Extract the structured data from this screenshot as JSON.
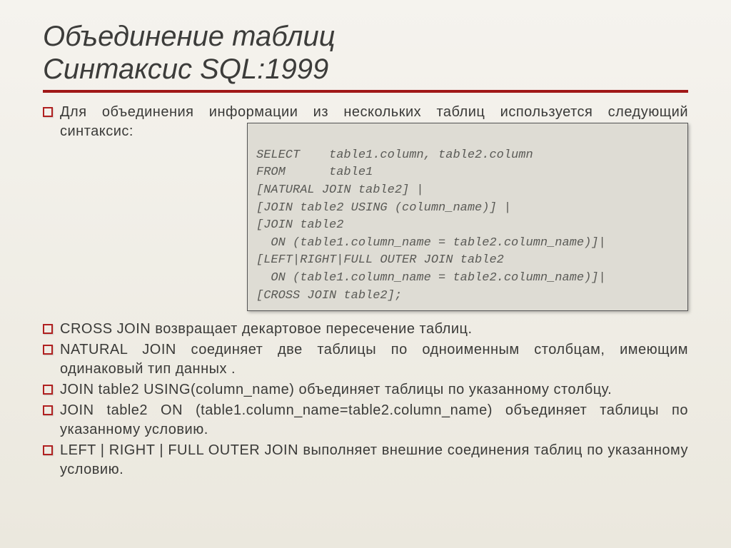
{
  "title_line1": "Объединение таблиц",
  "title_line2": "Синтаксис SQL:1999",
  "intro": "Для объединения информации из нескольких таблиц используется следующий синтаксис:",
  "code": [
    "SELECT    table1.column, table2.column",
    "FROM      table1",
    "[NATURAL JOIN table2] |",
    "[JOIN table2 USING (column_name)] |",
    "[JOIN table2",
    "  ON (table1.column_name = table2.column_name)]|",
    "[LEFT|RIGHT|FULL OUTER JOIN table2",
    "  ON (table1.column_name = table2.column_name)]|",
    "[CROSS JOIN table2];"
  ],
  "bullets": [
    "CROSS JOIN возвращает декартовое пересечение таблиц.",
    "NATURAL JOIN соединяет две таблицы по одноименным  столбцам, имеющим одинаковый тип данных .",
    "JOIN table2   USING(column_name) объединяет таблицы по указанному столбцу.",
    "JOIN table2 ON (table1.column_name=table2.column_name) объединяет таблицы по указанному условию.",
    "LEFT | RIGHT | FULL OUTER JOIN выполняет внешние соединения таблиц по указанному условию."
  ]
}
